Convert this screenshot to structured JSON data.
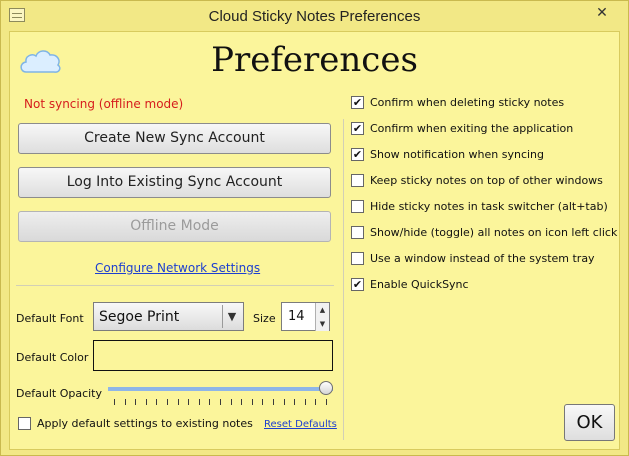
{
  "window": {
    "title": "Cloud Sticky Notes Preferences",
    "close_glyph": "✕"
  },
  "page": {
    "heading": "Preferences",
    "status": "Not syncing (offline mode)"
  },
  "buttons": {
    "create": "Create New Sync Account",
    "login": "Log Into Existing Sync Account",
    "offline": "Offline Mode",
    "ok": "OK"
  },
  "links": {
    "network": "Configure Network Settings",
    "reset": "Reset Defaults"
  },
  "settings": {
    "font_label": "Default Font",
    "font_value": "Segoe Print",
    "size_label": "Size",
    "size_value": "14",
    "color_label": "Default Color",
    "opacity_label": "Default Opacity",
    "opacity_value": 1.0,
    "apply_label": "Apply default settings to existing notes",
    "apply_checked": false
  },
  "options": [
    {
      "label": "Confirm when deleting sticky notes",
      "checked": true
    },
    {
      "label": "Confirm when exiting the application",
      "checked": true
    },
    {
      "label": "Show notification when syncing",
      "checked": true
    },
    {
      "label": "Keep sticky notes on top of other windows",
      "checked": false
    },
    {
      "label": "Hide sticky notes in task switcher (alt+tab)",
      "checked": false
    },
    {
      "label": "Show/hide (toggle) all notes on icon left click",
      "checked": false
    },
    {
      "label": "Use a window instead of the system tray",
      "checked": false
    },
    {
      "label": "Enable QuickSync",
      "checked": true
    }
  ],
  "icons": {
    "app": "notes-icon",
    "cloud": "cloud-icon",
    "dropdown": "chevron-down-icon",
    "spin_up": "arrow-up-icon",
    "spin_down": "arrow-down-icon"
  },
  "colors": {
    "background": "#fbf59b",
    "status": "#d61d1d",
    "link": "#1d3fd0"
  }
}
